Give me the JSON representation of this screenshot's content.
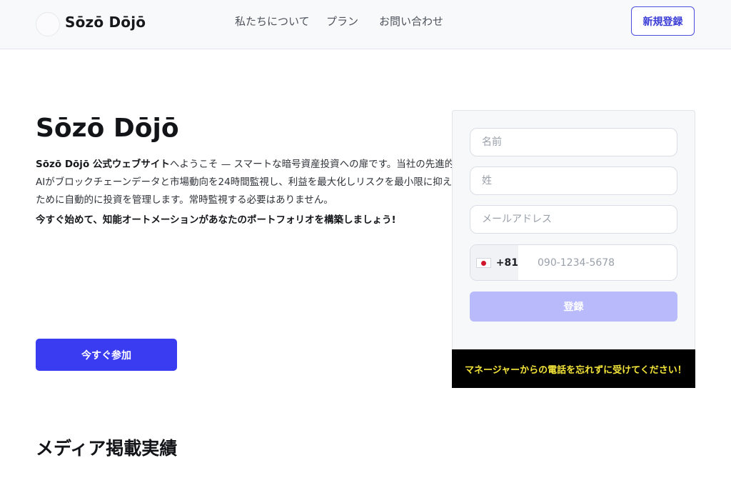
{
  "header": {
    "logo_icon": "brand-logo-mark",
    "brand": "Sōzō Dōjō",
    "nav": {
      "about": "私たちについて",
      "plans": "プラン",
      "contact": "お問い合わせ"
    },
    "signup_label": "新規登録"
  },
  "hero": {
    "title": "Sōzō Dōjō",
    "desc_bold": "Sōzō Dōjō 公式ウェブサイト",
    "desc_rest": "へようこそ — スマートな暗号資産投資への扉です。当社の先進的なAIがブロックチェーンデータと市場動向を24時間監視し、利益を最大化しリスクを最小限に抑えるために自動的に投資を管理します。常時監視する必要はありません。",
    "cta_text": "今すぐ始めて、知能オートメーションがあなたのポートフォリオを構築しましょう!",
    "join_label": "今すぐ参加"
  },
  "form": {
    "first_name_placeholder": "名前",
    "last_name_placeholder": "姓",
    "email_placeholder": "メールアドレス",
    "country_flag": "japan-flag",
    "dial_code": "+81",
    "phone_placeholder": "090-1234-5678",
    "submit_label": "登録",
    "notice": "マネージャーからの電話を忘れずに受けてください！"
  },
  "media": {
    "heading": "メディア掲載実績"
  },
  "colors": {
    "accent": "#3a3cf2",
    "submit_disabled": "#b8bafc",
    "notice_bg": "#000000",
    "notice_text": "#f3e43a"
  }
}
